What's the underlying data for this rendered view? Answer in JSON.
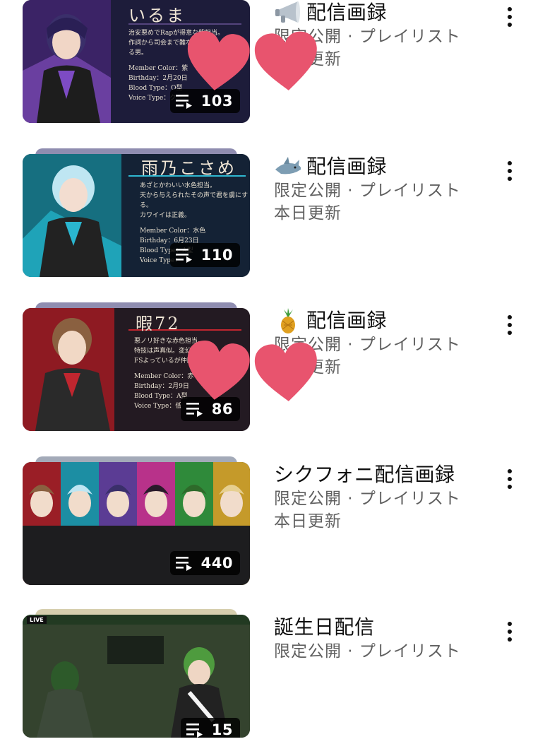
{
  "playlists": [
    {
      "title": "配信画録",
      "emoji_icon": "megaphone-icon",
      "visibility": "限定公開 · プレイリスト",
      "updated": "本日更新",
      "video_count": "103",
      "card_name": "いるま",
      "card_lines": [
        "治安悪めでRapが得意な紫担当。",
        "作詞から司会まで難なくこなす",
        "る男。",
        "Member Color：紫",
        "Birthday：2月20日",
        "Blood Type：O型",
        "Voice Type：ク"
      ],
      "accent": "#6a3fa0"
    },
    {
      "title": "配信画録",
      "emoji_icon": "shark-icon",
      "visibility": "限定公開 · プレイリスト",
      "updated": "本日更新",
      "video_count": "110",
      "card_name": "雨乃こさめ",
      "card_lines": [
        "あざとかわいい水色担当。",
        "天から与えられたその声で君を虜にする。",
        "カワイイは正義。",
        "Member Color：水色",
        "Birthday：6月23日",
        "Blood Type：A型",
        "Voice Type："
      ],
      "accent": "#1fa3b8"
    },
    {
      "title": "配信画録",
      "emoji_icon": "pineapple-icon",
      "visibility": "限定公開 · プレイリスト",
      "updated": "本日更新",
      "video_count": "86",
      "card_name": "暇72",
      "card_lines": [
        "悪ノリ好きな赤色担当。",
        "特技は声真似。変幻自在な七",
        "FSよっているが仲間",
        "Member Color：赤",
        "Birthday：2月9日",
        "Blood Type：A型",
        "Voice Type：低"
      ],
      "accent": "#b3202a"
    },
    {
      "title": "シクフォニ配信画録",
      "emoji_icon": "",
      "visibility": "限定公開 · プレイリスト",
      "updated": "本日更新",
      "video_count": "440",
      "accent": "#333333"
    },
    {
      "title": "誕生日配信",
      "emoji_icon": "",
      "visibility": "限定公開 · プレイリスト",
      "updated": "",
      "video_count": "15",
      "live_label": "LIVE",
      "accent": "#2e4a2a"
    }
  ],
  "colors": {
    "heart": "#e8546e",
    "title_text": "#0f0f0f",
    "meta_text": "#606060",
    "badge_bg": "#000000"
  }
}
